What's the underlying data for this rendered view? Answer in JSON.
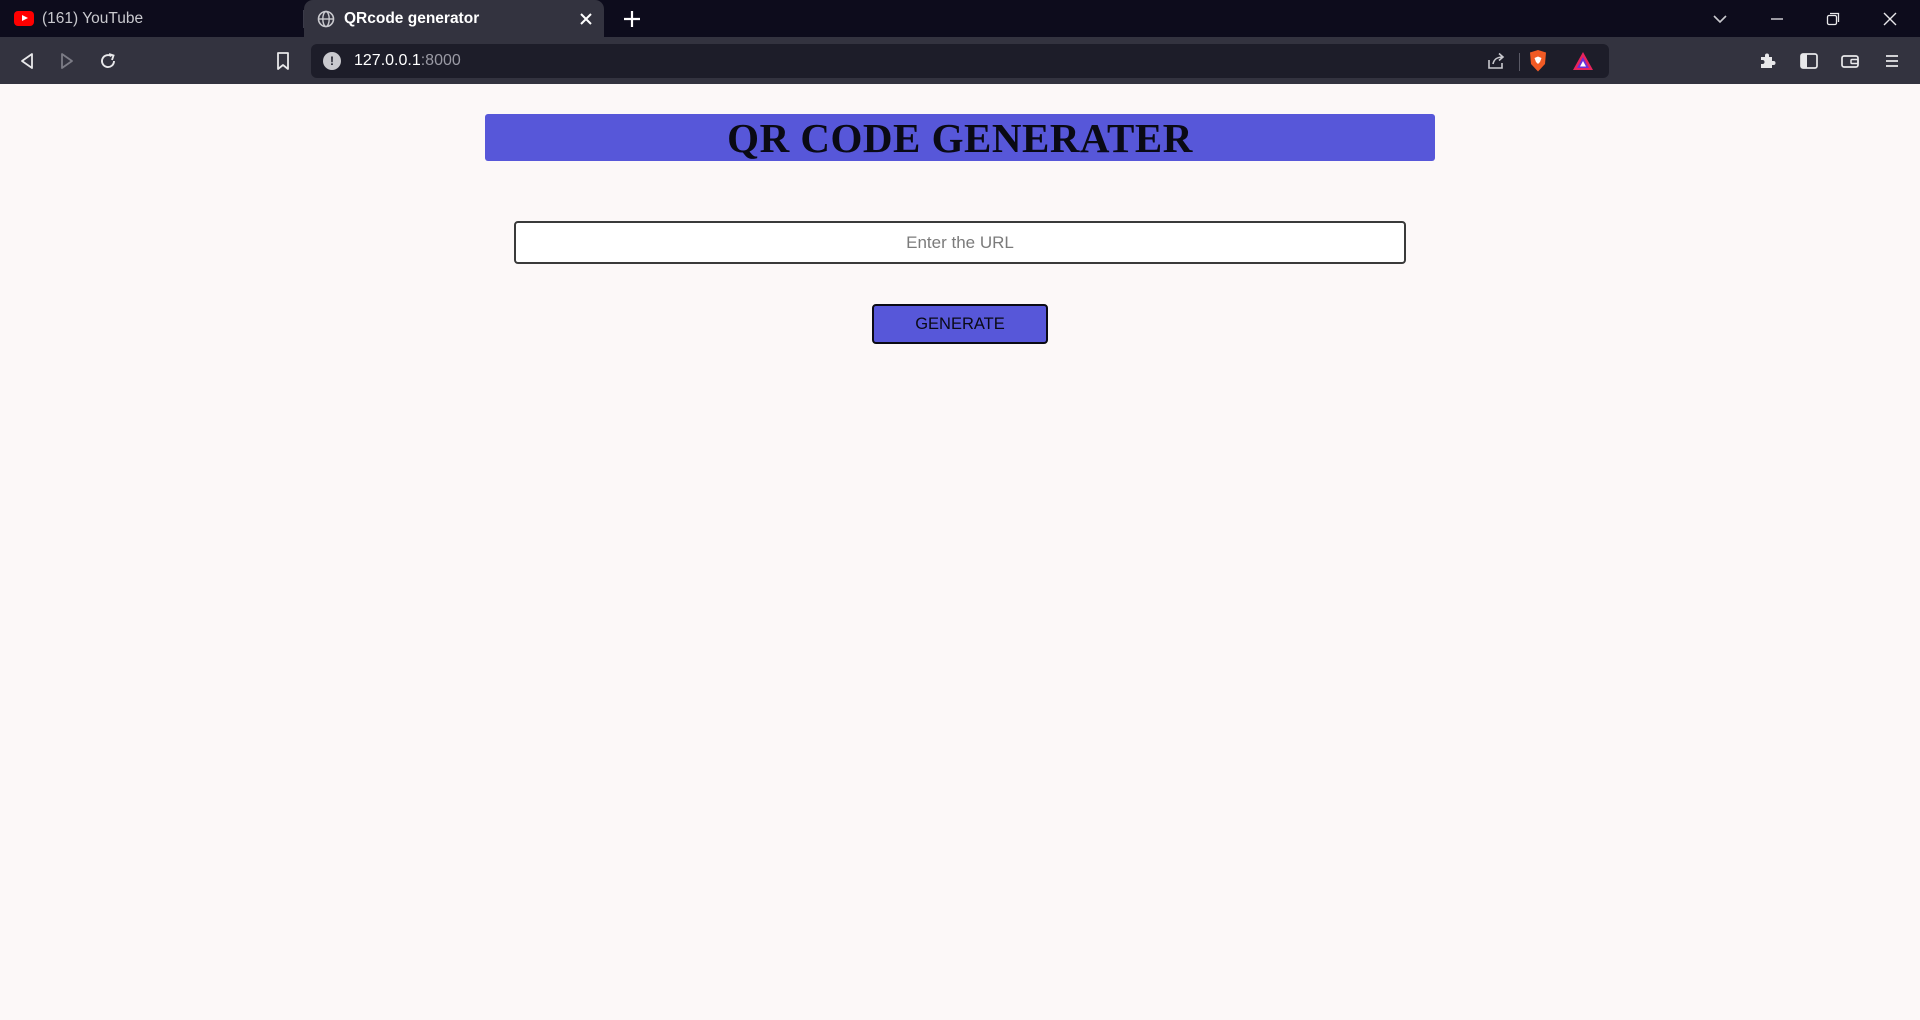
{
  "browser": {
    "tabs": [
      {
        "label": "(161) YouTube",
        "icon": "youtube-icon",
        "active": false
      },
      {
        "label": "QRcode generator",
        "icon": "globe-icon",
        "active": true
      }
    ],
    "address": {
      "host": "127.0.0.1",
      "port": ":8000"
    }
  },
  "page": {
    "title": "QR CODE GENERATER",
    "url_input": {
      "placeholder": "Enter the URL",
      "value": ""
    },
    "generate_label": "GENERATE"
  },
  "colors": {
    "accent": "#5757d9",
    "page_background": "#fcf8f8",
    "tabstrip": "#0d0c1c",
    "toolbar": "#33333f"
  }
}
